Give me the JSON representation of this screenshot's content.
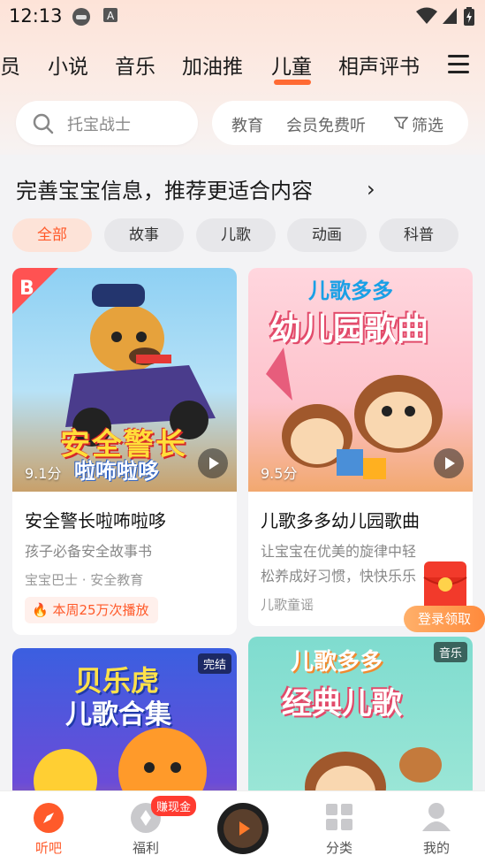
{
  "status_bar": {
    "time": "12:13"
  },
  "tabs": [
    {
      "label": "员"
    },
    {
      "label": "小说"
    },
    {
      "label": "音乐"
    },
    {
      "label": "加油推"
    },
    {
      "label": "儿童",
      "active": true
    },
    {
      "label": "相声评书"
    }
  ],
  "search": {
    "placeholder": "托宝战士"
  },
  "filters": {
    "education": "教育",
    "member_free": "会员免费听",
    "filter": "筛选"
  },
  "banner": {
    "text": "完善宝宝信息，推荐更适合内容"
  },
  "chips": [
    {
      "label": "全部",
      "active": true
    },
    {
      "label": "故事"
    },
    {
      "label": "儿歌"
    },
    {
      "label": "动画"
    },
    {
      "label": "科普"
    }
  ],
  "cards": [
    {
      "cover_title": "安全警长",
      "cover_subtitle": "啦咘啦哆",
      "score": "9.1分",
      "title": "安全警长啦咘啦哆",
      "desc": "孩子必备安全故事书",
      "tag": "宝宝巴士 · 安全教育",
      "hot": "本周25万次播放"
    },
    {
      "cover_title": "儿歌多多",
      "cover_subtitle": "幼儿园歌曲",
      "score": "9.5分",
      "title": "儿歌多多幼儿园歌曲",
      "desc": "让宝宝在优美的旋律中轻松养成好习惯，快快乐乐",
      "tag": "儿歌童谣"
    },
    {
      "cover_title": "贝乐虎",
      "cover_subtitle": "儿歌合集",
      "badge": "完结"
    },
    {
      "cover_title": "儿歌多多",
      "cover_subtitle": "经典儿歌",
      "badge": "音乐"
    }
  ],
  "promo": {
    "login": "登录领取"
  },
  "bottom_nav": {
    "items": [
      {
        "label": "听吧",
        "icon": "compass-icon",
        "active": true
      },
      {
        "label": "福利",
        "icon": "coin-icon"
      },
      {
        "label": "",
        "icon": "now-playing-disc"
      },
      {
        "label": "分类",
        "icon": "grid-icon"
      },
      {
        "label": "我的",
        "icon": "person-icon"
      }
    ],
    "earn_badge": "赚现金"
  },
  "colors": {
    "accent": "#ff5a2a",
    "chip_active_bg": "#fde3d8"
  }
}
